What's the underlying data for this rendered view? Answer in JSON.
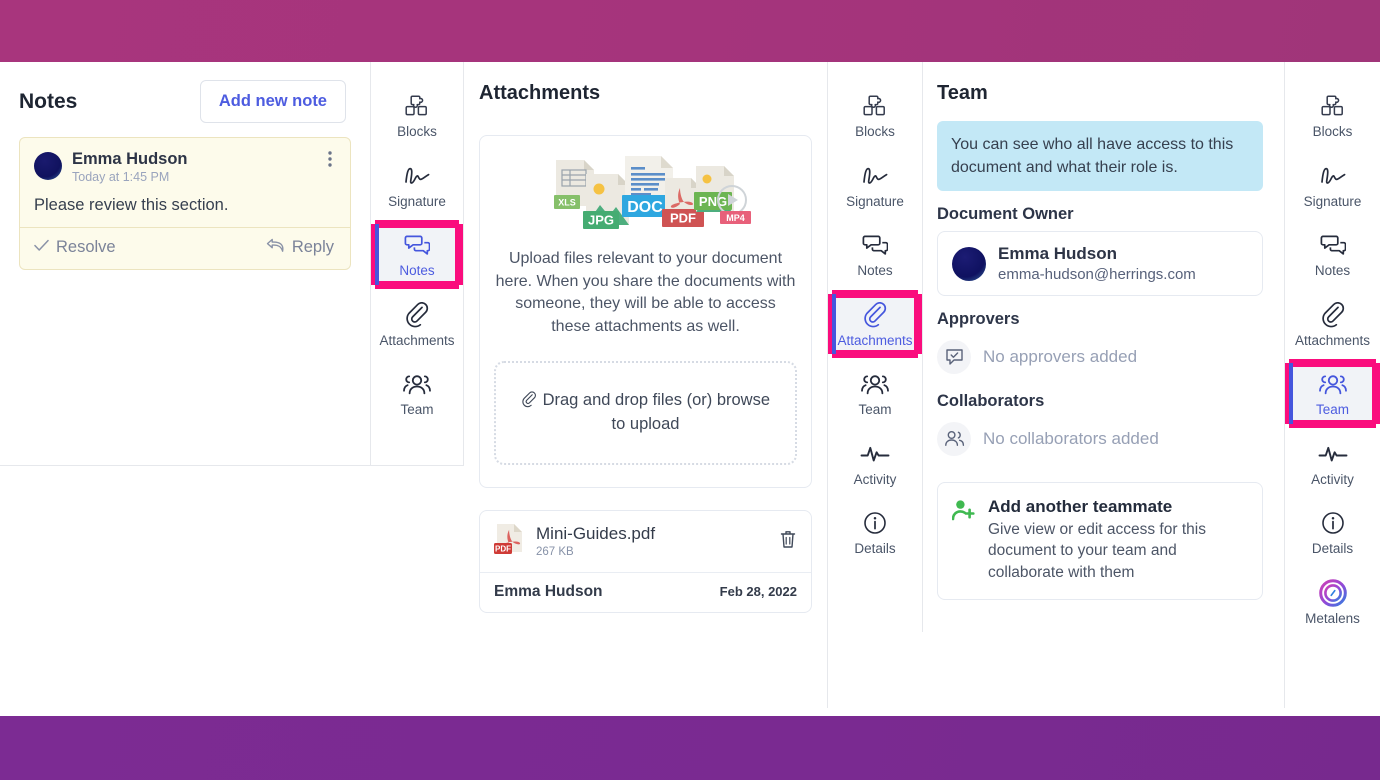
{
  "theme": {
    "top_band_color": "#a5347c",
    "bottom_band_color": "#7a2a91",
    "highlight_color": "#fa0d7d",
    "active_accent_color": "#4556dd",
    "link_color": "#4d5ce0",
    "info_banner_color": "#c3e8f6",
    "note_card_bg": "#fdfbeb"
  },
  "notes_panel": {
    "title": "Notes",
    "add_button_label": "Add new note",
    "note": {
      "author": "Emma Hudson",
      "timestamp": "Today at 1:45 PM",
      "body": "Please review this section.",
      "kebab_icon": "more-vertical-icon",
      "resolve_label": "Resolve",
      "resolve_icon": "check-icon",
      "reply_label": "Reply",
      "reply_icon": "reply-arrow-icon"
    }
  },
  "rail_left": {
    "items": [
      {
        "label": "Blocks",
        "icon": "blocks-puzzle-icon",
        "active": false,
        "highlight": false
      },
      {
        "label": "Signature",
        "icon": "signature-icon",
        "active": false,
        "highlight": false
      },
      {
        "label": "Notes",
        "icon": "notes-chat-icon",
        "active": true,
        "highlight": true
      },
      {
        "label": "Attachments",
        "icon": "paperclip-icon",
        "active": false,
        "highlight": false
      },
      {
        "label": "Team",
        "icon": "team-people-icon",
        "active": false,
        "highlight": false
      }
    ]
  },
  "rail_middle": {
    "items": [
      {
        "label": "Blocks",
        "icon": "blocks-puzzle-icon",
        "active": false,
        "highlight": false
      },
      {
        "label": "Signature",
        "icon": "signature-icon",
        "active": false,
        "highlight": false
      },
      {
        "label": "Notes",
        "icon": "notes-chat-icon",
        "active": false,
        "highlight": false
      },
      {
        "label": "Attachments",
        "icon": "paperclip-icon",
        "active": true,
        "highlight": true
      },
      {
        "label": "Team",
        "icon": "team-people-icon",
        "active": false,
        "highlight": false
      },
      {
        "label": "Activity",
        "icon": "activity-pulse-icon",
        "active": false,
        "highlight": false
      },
      {
        "label": "Details",
        "icon": "info-circle-icon",
        "active": false,
        "highlight": false
      }
    ]
  },
  "rail_right": {
    "items": [
      {
        "label": "Blocks",
        "icon": "blocks-puzzle-icon",
        "active": false,
        "highlight": false
      },
      {
        "label": "Signature",
        "icon": "signature-icon",
        "active": false,
        "highlight": false
      },
      {
        "label": "Notes",
        "icon": "notes-chat-icon",
        "active": false,
        "highlight": false
      },
      {
        "label": "Attachments",
        "icon": "paperclip-icon",
        "active": false,
        "highlight": false
      },
      {
        "label": "Team",
        "icon": "team-people-icon",
        "active": true,
        "highlight": true
      },
      {
        "label": "Activity",
        "icon": "activity-pulse-icon",
        "active": false,
        "highlight": false
      },
      {
        "label": "Details",
        "icon": "info-circle-icon",
        "active": false,
        "highlight": false
      },
      {
        "label": "Metalens",
        "icon": "metalens-ring-icon",
        "active": false,
        "highlight": false
      }
    ]
  },
  "attachments_panel": {
    "title": "Attachments",
    "illustration_labels": [
      "XLS",
      "JPG",
      "DOC",
      "PDF",
      "PNG",
      "MP4"
    ],
    "description": "Upload files relevant to your document here. When you share the documents with someone, they will be able to access these attachments as well.",
    "dropzone_label": "Drag and drop files (or) browse to upload",
    "dropzone_icon": "paperclip-icon",
    "files": [
      {
        "name": "Mini-Guides.pdf",
        "size": "267 KB",
        "type_badge": "PDF",
        "owner": "Emma Hudson",
        "date": "Feb 28, 2022",
        "delete_icon": "trash-icon"
      }
    ]
  },
  "team_panel": {
    "title": "Team",
    "info_banner": "You can see who all have access to this document and what their role is.",
    "owner_section_label": "Document Owner",
    "owner": {
      "name": "Emma Hudson",
      "email": "emma-hudson@herrings.com"
    },
    "approvers_section_label": "Approvers",
    "approvers_empty": "No approvers added",
    "approvers_empty_icon": "approval-chat-icon",
    "collaborators_section_label": "Collaborators",
    "collaborators_empty": "No collaborators added",
    "collaborators_empty_icon": "people-icon",
    "add_teammate": {
      "icon": "add-person-icon",
      "title": "Add another teammate",
      "description": "Give view or edit access for this document to your team and collaborate with them"
    }
  }
}
